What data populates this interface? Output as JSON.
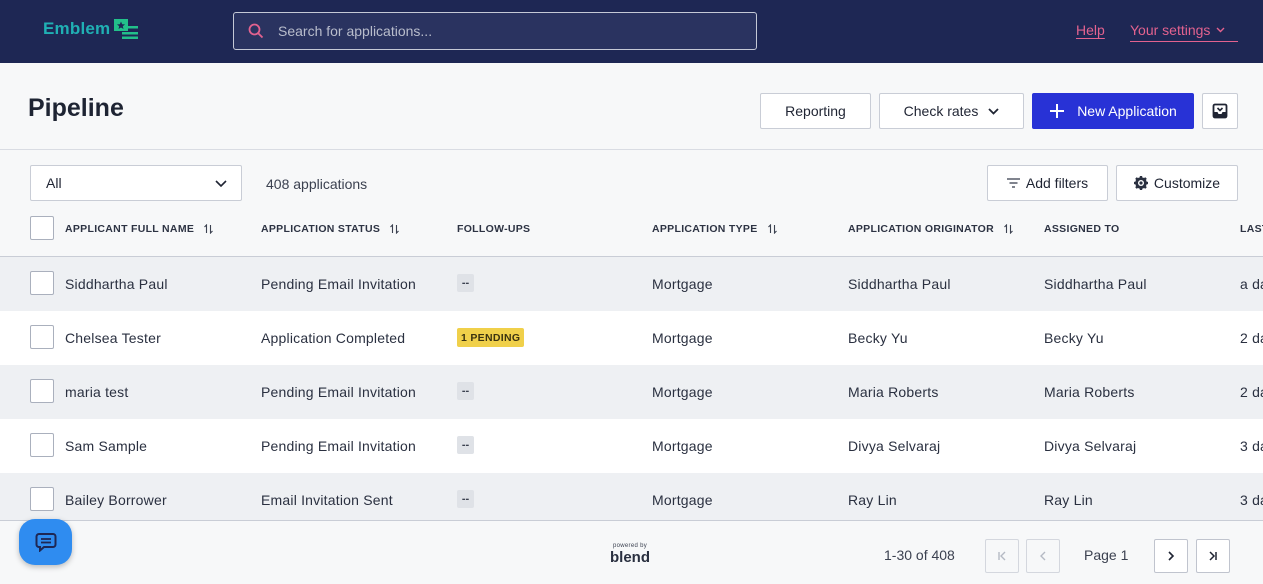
{
  "brand": {
    "name": "Emblem"
  },
  "search": {
    "placeholder": "Search for applications..."
  },
  "nav": {
    "help": "Help",
    "settings": "Your settings"
  },
  "header": {
    "title": "Pipeline",
    "reporting": "Reporting",
    "check_rates": "Check rates",
    "new_application": "New Application"
  },
  "toolbar": {
    "filter_value": "All",
    "count": "408 applications",
    "add_filters": "Add filters",
    "customize": "Customize"
  },
  "columns": {
    "name": "APPLICANT FULL NAME",
    "status": "APPLICATION STATUS",
    "followups": "FOLLOW-UPS",
    "type": "APPLICATION TYPE",
    "originator": "APPLICATION ORIGINATOR",
    "assigned": "ASSIGNED TO",
    "last": "LAST"
  },
  "rows": [
    {
      "name": "Siddhartha Paul",
      "status": "Pending Email Invitation",
      "followup": "--",
      "type": "Mortgage",
      "originator": "Siddhartha Paul",
      "assigned": "Siddhartha Paul",
      "last": "a da"
    },
    {
      "name": "Chelsea Tester",
      "status": "Application Completed",
      "followup": "1 PENDING",
      "type": "Mortgage",
      "originator": "Becky Yu",
      "assigned": "Becky Yu",
      "last": "2 da"
    },
    {
      "name": "maria test",
      "status": "Pending Email Invitation",
      "followup": "--",
      "type": "Mortgage",
      "originator": "Maria Roberts",
      "assigned": "Maria Roberts",
      "last": "2 da"
    },
    {
      "name": "Sam Sample",
      "status": "Pending Email Invitation",
      "followup": "--",
      "type": "Mortgage",
      "originator": "Divya Selvaraj",
      "assigned": "Divya Selvaraj",
      "last": "3 da"
    },
    {
      "name": "Bailey Borrower",
      "status": "Email Invitation Sent",
      "followup": "--",
      "type": "Mortgage",
      "originator": "Ray Lin",
      "assigned": "Ray Lin",
      "last": "3 da"
    }
  ],
  "footer": {
    "powered_by": "powered by",
    "powered_brand": "blend",
    "range": "1-30 of 408",
    "page": "Page 1"
  },
  "colors": {
    "nav_bg": "#1e2754",
    "brand": "#20b0b4",
    "link": "#e3628f",
    "primary": "#2832d6",
    "badge": "#f0d04a",
    "chat": "#2f8cf0"
  },
  "icons": [
    "search-icon",
    "chevron-down-icon",
    "plus-icon",
    "inbox-icon",
    "filter-icon",
    "gear-icon",
    "sort-icon",
    "first-page-icon",
    "prev-page-icon",
    "next-page-icon",
    "last-page-icon",
    "chat-icon"
  ]
}
